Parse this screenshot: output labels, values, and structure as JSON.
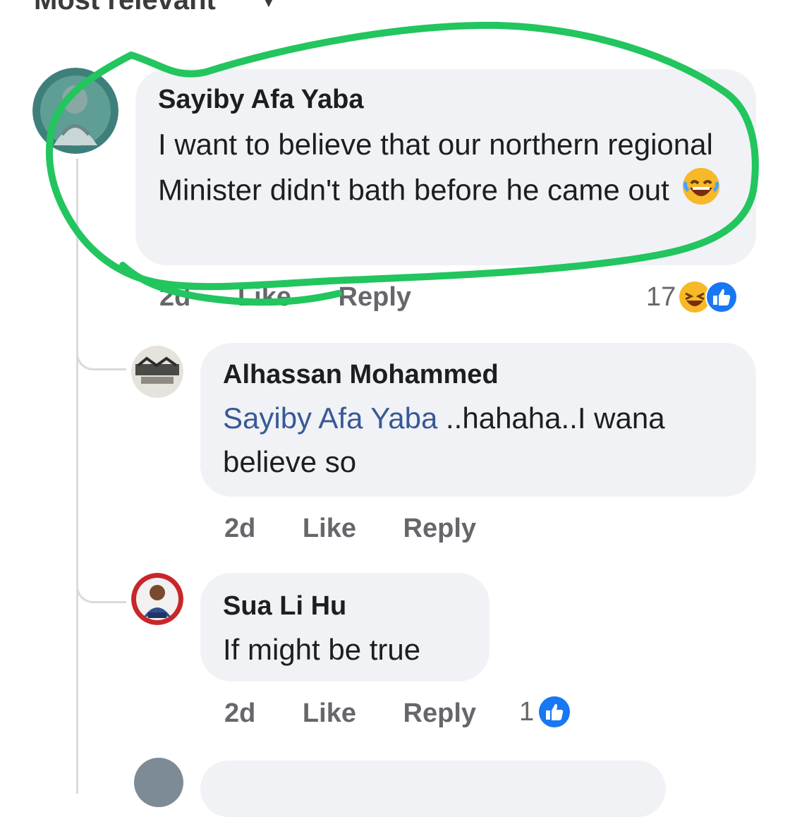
{
  "sort": {
    "label": "Most relevant"
  },
  "comments": [
    {
      "author": "Sayiby Afa Yaba",
      "text": "I want to believe that our northern regional Minister didn't bath before he came out",
      "time": "2d",
      "like": "Like",
      "reply": "Reply",
      "reaction_count": "17",
      "reaction_icons": [
        "laugh-icon",
        "like-icon"
      ]
    },
    {
      "author": "Alhassan Mohammed",
      "mention": "Sayiby Afa Yaba",
      "text": " ..hahaha..I wana believe so",
      "time": "2d",
      "like": "Like",
      "reply": "Reply"
    },
    {
      "author": "Sua Li Hu",
      "text": "If might be true",
      "time": "2d",
      "like": "Like",
      "reply": "Reply",
      "reaction_count": "1",
      "reaction_icons": [
        "like-icon"
      ]
    }
  ],
  "colors": {
    "highlight_stroke": "#22c55e",
    "mention": "#385898",
    "like_blue": "#1877f2",
    "bubble": "#f0f2f5"
  }
}
